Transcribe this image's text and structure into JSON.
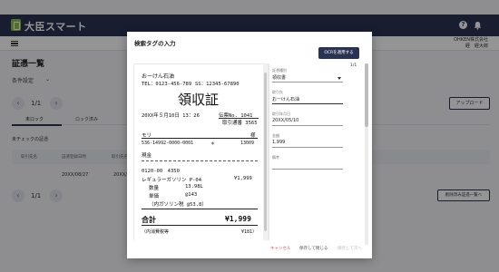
{
  "app": {
    "title": "大臣スマート",
    "company_name": "OHKEN株式会社",
    "company_user": "経　経大郎"
  },
  "page": {
    "title": "証憑一覧",
    "condition_label": "条件設定",
    "pager": "1/1",
    "upload_label": "アップロード",
    "tabs": [
      {
        "label": "未ロック"
      },
      {
        "label": "ロック済み"
      }
    ],
    "unchecked_label": "未チェックの証憑",
    "columns": [
      "取引先名",
      "証憑登録日時",
      "取引先名",
      "取引先名"
    ],
    "rows": [
      {
        "date": "20XX/08/27",
        "amount": "20XX/05/10"
      }
    ],
    "processed_label": "削除済み証憑一覧へ"
  },
  "modal": {
    "title": "検索タグの入力",
    "ocr_button": "OCRを適用する",
    "page_indicator": "1/1",
    "fields": [
      {
        "label": "証憑種別",
        "value": "領収書"
      },
      {
        "label": "取引先",
        "value": "おーけん石油"
      },
      {
        "label": "取引年月日",
        "value": "20XX/05/10"
      },
      {
        "label": "金額",
        "value": "1,999"
      },
      {
        "label": "備考",
        "value": ""
      }
    ],
    "cancel_label": "キャンセル",
    "save_close_label": "保存して閉じる",
    "save_next_label": "保存して次へ"
  },
  "receipt": {
    "shop": "おーけん石油",
    "phone": "TEL：0123-456-789",
    "ss": "SS：12345-67890",
    "heading": "領収証",
    "datetime": "20XX年５月10日 13：26",
    "voucher_no": "伝票No. 1041",
    "trans_no": "取引通番 3565",
    "name_col": "モリ",
    "yen_col": "様",
    "card_no": "536-14992-0000-0001",
    "card_mark": "＊",
    "card_num2": "13009",
    "cash": "現金",
    "code": "0120-00　4350",
    "item": "レギュラーガソリン P-04",
    "item_amount": "¥1,999",
    "qty_label": "数量",
    "qty_value": "13.98L",
    "unit_label": "単価",
    "unit_value": "@143",
    "tax_note": "（内ガソリン税 @53.8）",
    "total_label": "合計",
    "total_value": "¥1,999",
    "inner_tax": "（内消費税等",
    "inner_tax_value": "¥181）"
  },
  "colors": {
    "navy": "#2a3354",
    "cancel_red": "#e05050",
    "logo_green": "#8fc04c"
  }
}
